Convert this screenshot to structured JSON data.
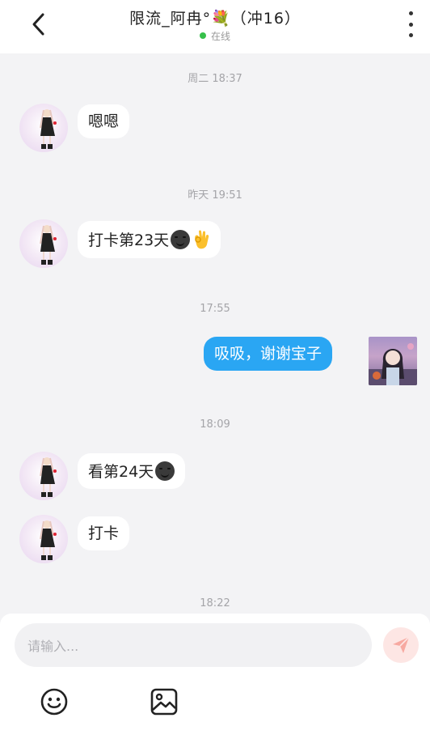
{
  "header": {
    "title": "限流_阿冉°💐（冲16）",
    "status": "在线"
  },
  "messages": [
    {
      "type": "timestamp",
      "text": "周二 18:37"
    },
    {
      "type": "incoming",
      "text": "嗯嗯"
    },
    {
      "type": "timestamp",
      "text": "昨天 19:51"
    },
    {
      "type": "incoming",
      "text": "打卡第23天",
      "emojis": [
        "dark-moon-face-emoji",
        "ok-hand-emoji"
      ]
    },
    {
      "type": "timestamp",
      "text": "17:55"
    },
    {
      "type": "outgoing",
      "text": "吸吸，谢谢宝子"
    },
    {
      "type": "timestamp",
      "text": "18:09"
    },
    {
      "type": "incoming",
      "text": "看第24天",
      "emojis": [
        "dark-moon-face-emoji"
      ]
    },
    {
      "type": "incoming",
      "text": "打卡"
    },
    {
      "type": "timestamp",
      "text": "18:22"
    }
  ],
  "composer": {
    "placeholder": "请输入...",
    "send_icon": "send-icon",
    "emoji_icon": "emoji-icon",
    "image_icon": "image-icon"
  },
  "colors": {
    "outgoing_bubble": "#2aa6f3",
    "online_dot": "#36c04a",
    "send_button_bg": "#fde6e4",
    "send_icon": "#f7a9a1"
  }
}
